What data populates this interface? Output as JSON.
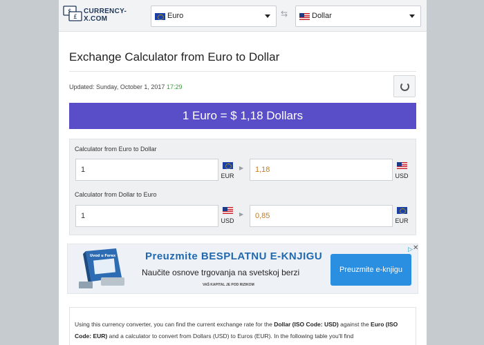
{
  "header": {
    "logo_text_line1": "CURRENCY-",
    "logo_text_line2": "X.COM",
    "from_currency": "Euro",
    "to_currency": "Dollar",
    "swap_icon": "swap-arrows-icon"
  },
  "title": "Exchange Calculator from Euro to Dollar",
  "updated": {
    "label": "Updated: Sunday, October 1, 2017",
    "time": "17:29"
  },
  "rate_banner": "1 Euro = $ 1,18 Dollars",
  "calculators": [
    {
      "label": "Calculator from Euro to Dollar",
      "input_value": "1",
      "input_currency": "EUR",
      "output_value": "1,18",
      "output_currency": "USD"
    },
    {
      "label": "Calculator from Dollar to Euro",
      "input_value": "1",
      "input_currency": "USD",
      "output_value": "0,85",
      "output_currency": "EUR"
    }
  ],
  "ad": {
    "book_label": "Uvod u Forex",
    "headline": "Preuzmite  BESPLATNU  E-KNJIGU",
    "subline": "Naučite osnove trgovanja na svetskoj berzi",
    "fine_print": "VAŠ KAPITAL JE POD RIZIKOM",
    "button_label": "Preuzmite e-knjigu",
    "choices_icon": "▷",
    "close_icon": "✕"
  },
  "description": {
    "p1_a": "Using this currency converter, you can find the current exchange rate for the ",
    "p1_b": "Dollar (ISO Code: USD)",
    "p1_c": " against the ",
    "p1_d": "Euro",
    "p2_a": "(ISO Code: EUR)",
    "p2_b": " and a calculator to convert from Dollars (USD) to Euros (EUR). In the following table you'll find"
  },
  "colors": {
    "banner": "#5a4dc8",
    "output_value": "#c57a1e",
    "time": "#3a9a3a",
    "ad_headline": "#1f69b0",
    "ad_button": "#2a8fe0"
  }
}
